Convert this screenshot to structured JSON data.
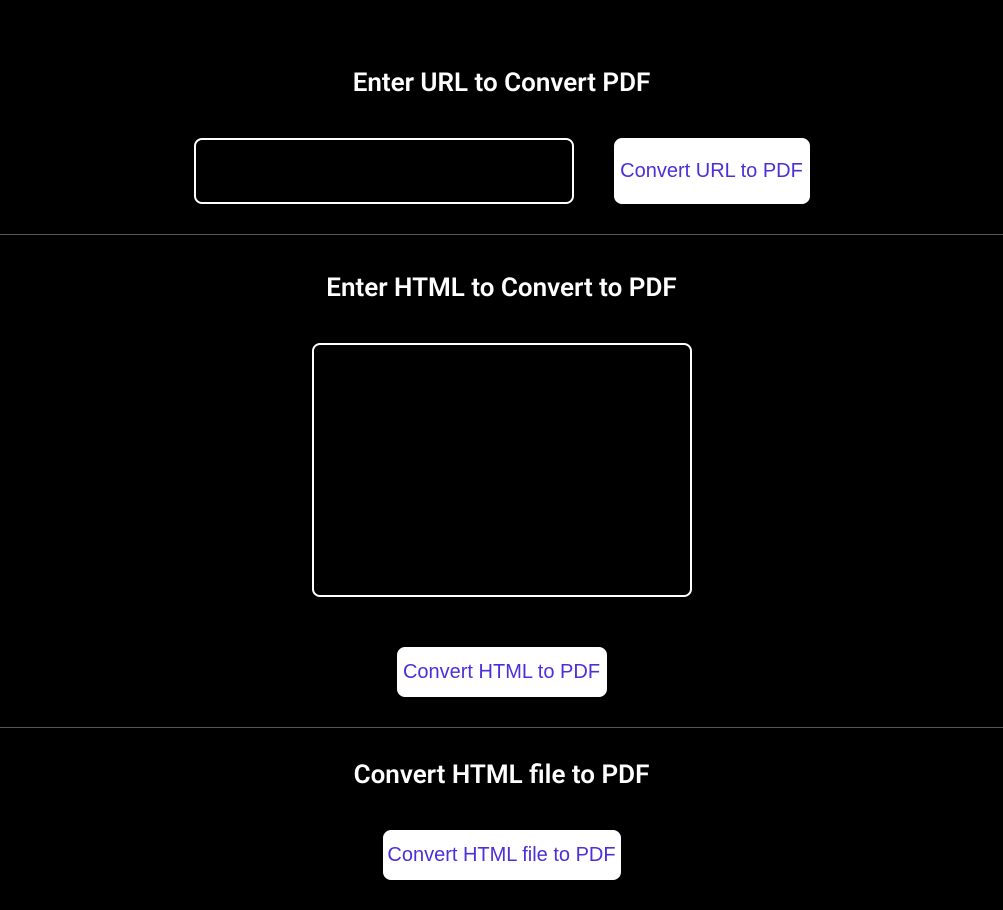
{
  "sections": {
    "url": {
      "title": "Enter URL to Convert PDF",
      "input_value": "",
      "button_label": "Convert URL to PDF"
    },
    "html": {
      "title": "Enter HTML to Convert to PDF",
      "textarea_value": "",
      "button_label": "Convert HTML to PDF"
    },
    "file": {
      "title": "Convert HTML file to PDF",
      "button_label": "Convert HTML file to PDF"
    }
  },
  "colors": {
    "background": "#000000",
    "text": "#ffffff",
    "button_bg": "#ffffff",
    "button_text": "#4d2fd9",
    "border": "#ffffff",
    "divider": "#555555"
  }
}
